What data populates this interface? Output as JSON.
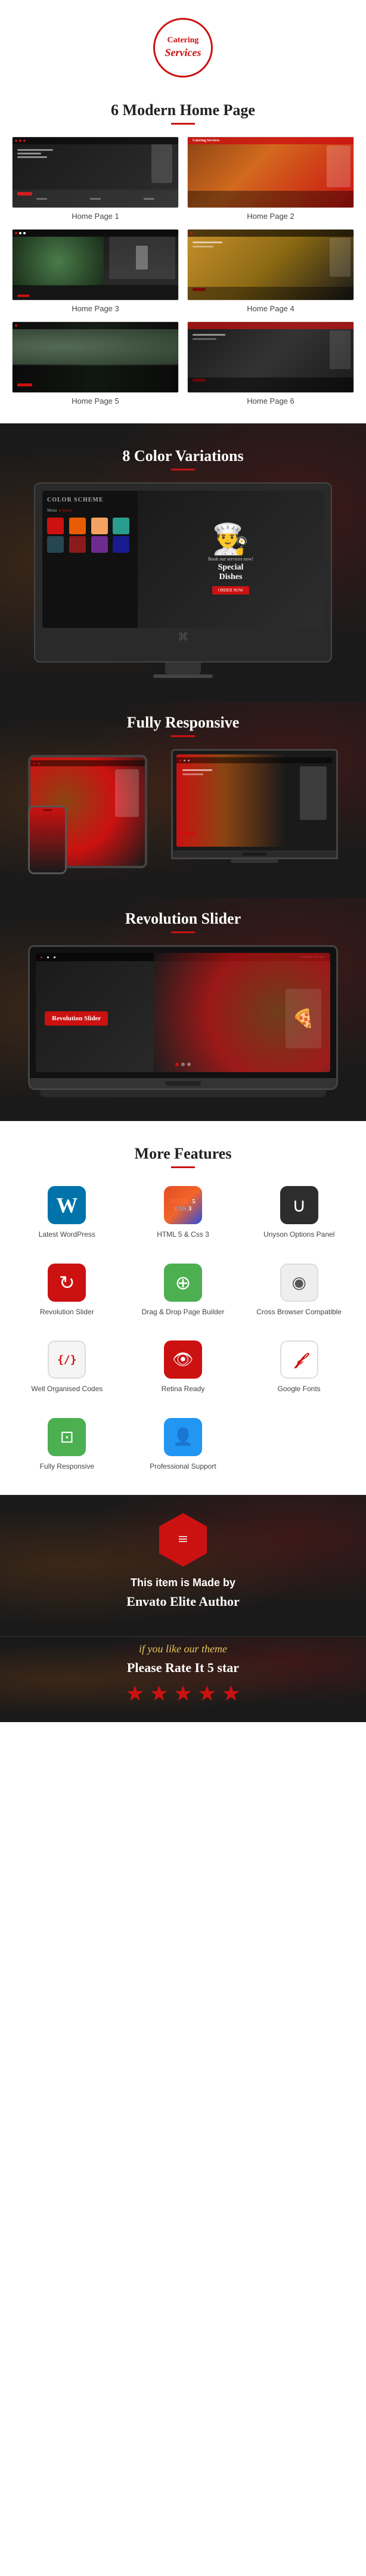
{
  "logo": {
    "line1": "Catering",
    "line2": "Services"
  },
  "homePages": {
    "sectionTitle": "6 Modern Home Page",
    "items": [
      {
        "id": 1,
        "label": "Home Page 1",
        "thumbClass": "thumb-dark"
      },
      {
        "id": 2,
        "label": "Home Page 2",
        "thumbClass": "thumb2-bg"
      },
      {
        "id": 3,
        "label": "Home Page 3",
        "thumbClass": "thumb3-bg"
      },
      {
        "id": 4,
        "label": "Home Page 4",
        "thumbClass": "thumb4-bg"
      },
      {
        "id": 5,
        "label": "Home Page 5",
        "thumbClass": "thumb5-bg"
      },
      {
        "id": 6,
        "label": "Home Page 6",
        "thumbClass": "thumb6-bg"
      }
    ]
  },
  "colorVariations": {
    "sectionTitle": "8 Color Variations",
    "colorSchemeLabel": "COLOR SCHEME",
    "swatches": [
      "#cc1111",
      "#e85d04",
      "#f4a261",
      "#2a9d8f",
      "#264653",
      "#8B1a1a",
      "#6d2b8f",
      "#1a1a8f"
    ],
    "monitorText1": "Book our services now!",
    "monitorText2": "Special",
    "monitorText3": "Dishes",
    "btnLabel": "ORDER NOW"
  },
  "responsive": {
    "sectionTitle": "Fully Responsive"
  },
  "revolutionSlider": {
    "sectionTitle": "Revolution Slider",
    "badgeLabel": "Revolution Slider"
  },
  "moreFeatures": {
    "sectionTitle": "More Features",
    "items": [
      {
        "id": "wordpress",
        "iconClass": "icon-wp",
        "label": "Latest WordPress",
        "iconSymbol": "W",
        "iconStyle": "wp"
      },
      {
        "id": "html5",
        "iconClass": "icon-html5",
        "label": "HTML 5 & Css 3",
        "iconSymbol": "HTML5\nCSS3",
        "iconStyle": "html5"
      },
      {
        "id": "unyson",
        "iconClass": "icon-unyson",
        "label": "Unyson Options Panel",
        "iconSymbol": "∪",
        "iconStyle": "unyson"
      },
      {
        "id": "revolution",
        "iconClass": "icon-rev",
        "label": "Revolution Slider",
        "iconSymbol": "↻",
        "iconStyle": "rev"
      },
      {
        "id": "drag",
        "iconClass": "icon-drag",
        "label": "Drag & Drop Page Builder",
        "iconSymbol": "⊕",
        "iconStyle": "drag"
      },
      {
        "id": "cross",
        "iconClass": "icon-cross",
        "label": "Cross Browser Compatible",
        "iconSymbol": "◯",
        "iconStyle": "cross"
      },
      {
        "id": "code",
        "iconClass": "icon-code",
        "label": "Well Organised Codes",
        "iconSymbol": "{/}",
        "iconStyle": "code"
      },
      {
        "id": "retina",
        "iconClass": "icon-retina",
        "label": "Retina Ready",
        "iconSymbol": "👁",
        "iconStyle": "retina"
      },
      {
        "id": "google",
        "iconClass": "icon-google",
        "label": "Google Fonts",
        "iconSymbol": "𝒻",
        "iconStyle": "google"
      },
      {
        "id": "responsive",
        "iconClass": "icon-responsive",
        "label": "Fully Responsive",
        "iconSymbol": "⊡",
        "iconStyle": "responsive"
      },
      {
        "id": "support",
        "iconClass": "icon-support",
        "label": "Professional Support",
        "iconSymbol": "👤",
        "iconStyle": "support"
      }
    ]
  },
  "envato": {
    "iconSymbol": "≡",
    "title": "This item is Made by",
    "subtitle": "Envato Elite Author"
  },
  "rate": {
    "italic": "if you like our theme",
    "bold": "Please Rate It 5 star",
    "stars": [
      "★",
      "★",
      "★",
      "★",
      "★"
    ]
  }
}
